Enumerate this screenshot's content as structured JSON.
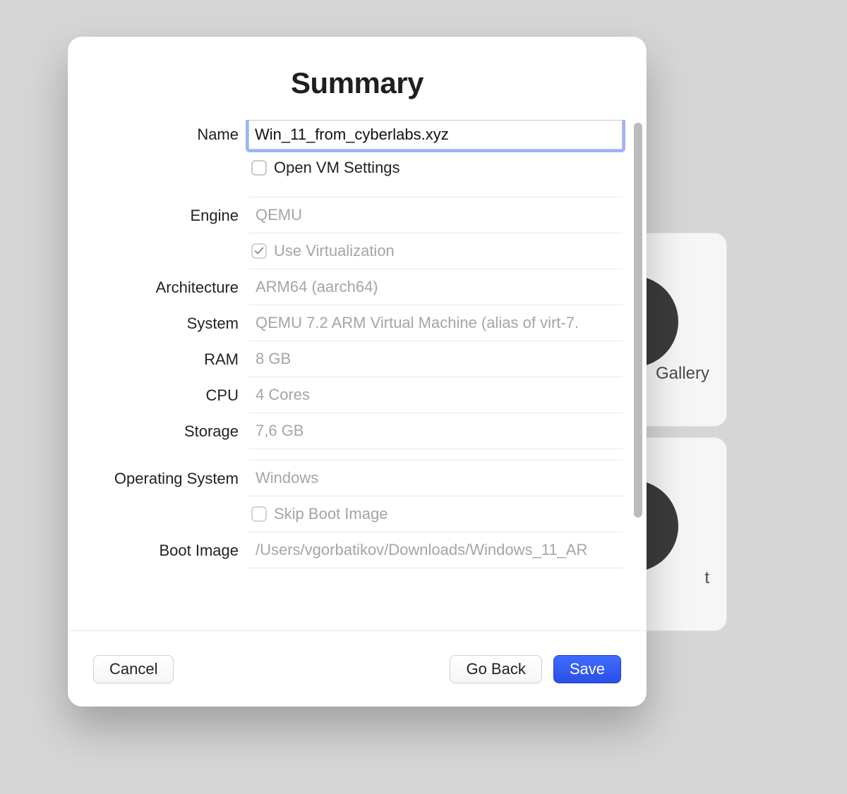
{
  "background": {
    "tile1_label": "Gallery",
    "tile2_label": "t"
  },
  "sheet": {
    "title": "Summary",
    "labels": {
      "name": "Name",
      "engine": "Engine",
      "architecture": "Architecture",
      "system": "System",
      "ram": "RAM",
      "cpu": "CPU",
      "storage": "Storage",
      "os": "Operating System",
      "boot_image": "Boot Image"
    },
    "values": {
      "name": "Win_11_from_cyberlabs.xyz",
      "open_vm_settings": "Open VM Settings",
      "engine": "QEMU",
      "use_virtualization": "Use Virtualization",
      "architecture": "ARM64 (aarch64)",
      "system": "QEMU 7.2 ARM Virtual Machine (alias of virt-7.",
      "ram": "8 GB",
      "cpu": "4 Cores",
      "storage": "7,6 GB",
      "os": "Windows",
      "skip_boot_image": "Skip Boot Image",
      "boot_image": "/Users/vgorbatikov/Downloads/Windows_11_AR"
    },
    "checks": {
      "open_vm_settings": false,
      "use_virtualization": true,
      "skip_boot_image": false
    },
    "footer": {
      "cancel": "Cancel",
      "go_back": "Go Back",
      "save": "Save"
    }
  }
}
